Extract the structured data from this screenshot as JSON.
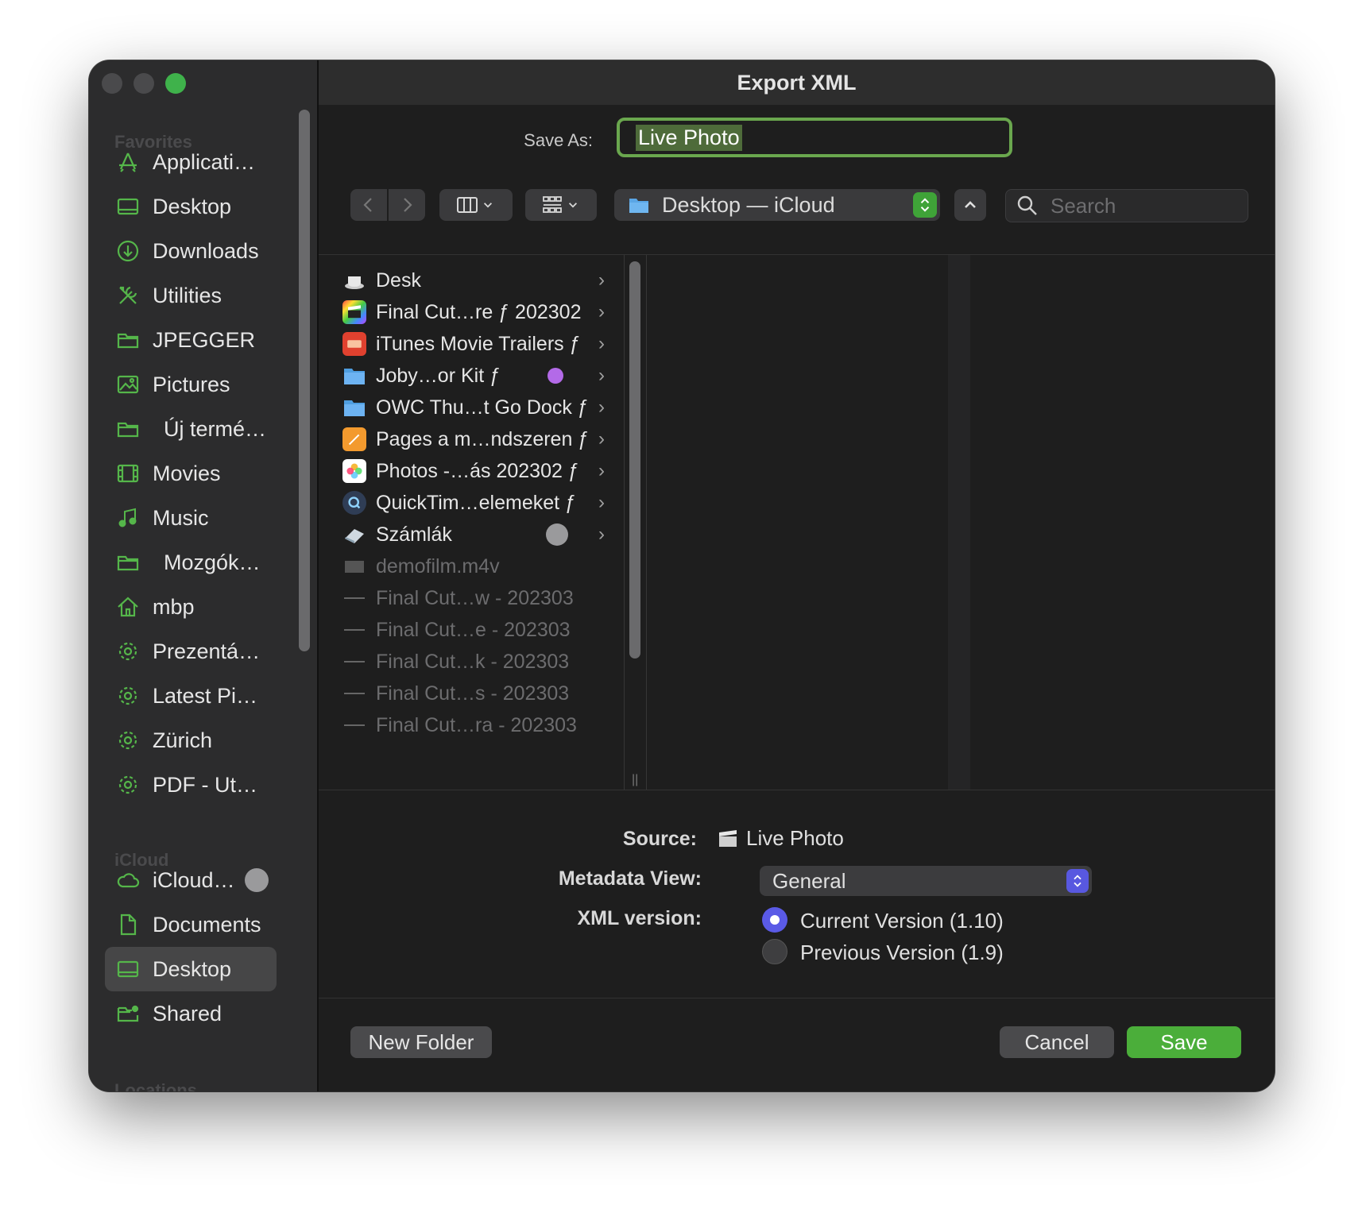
{
  "window": {
    "title": "Export XML"
  },
  "sidebar": {
    "sections": {
      "favorites": "Favorites",
      "icloud": "iCloud",
      "locations": "Locations"
    },
    "items": [
      {
        "label": "Applicati…",
        "icon": "applications-icon"
      },
      {
        "label": "Desktop",
        "icon": "desktop-icon"
      },
      {
        "label": "Downloads",
        "icon": "downloads-icon"
      },
      {
        "label": "Utilities",
        "icon": "utilities-icon"
      },
      {
        "label": "JPEGGER",
        "icon": "folder-icon"
      },
      {
        "label": "Pictures",
        "icon": "pictures-icon"
      },
      {
        "label": "Új termé…",
        "icon": "folder-icon"
      },
      {
        "label": "Movies",
        "icon": "movies-icon"
      },
      {
        "label": "Music",
        "icon": "music-icon"
      },
      {
        "label": "Mozgók…",
        "icon": "folder-icon"
      },
      {
        "label": "mbp",
        "icon": "home-icon"
      },
      {
        "label": "Prezentá…",
        "icon": "gear-icon"
      },
      {
        "label": "Latest Pi…",
        "icon": "gear-icon"
      },
      {
        "label": "Zürich",
        "icon": "gear-icon"
      },
      {
        "label": "PDF - Ut…",
        "icon": "gear-icon"
      }
    ],
    "icloud_items": [
      {
        "label": "iCloud…",
        "icon": "cloud-icon"
      },
      {
        "label": "Documents",
        "icon": "document-icon"
      },
      {
        "label": "Desktop",
        "icon": "desktop-icon",
        "selected": true
      },
      {
        "label": "Shared",
        "icon": "shared-folder-icon"
      }
    ]
  },
  "save_as": {
    "label": "Save As:",
    "value": "Live Photo"
  },
  "toolbar": {
    "path_popup": "Desktop — iCloud",
    "search_placeholder": "Search"
  },
  "browser": {
    "files": [
      {
        "name": "Desk",
        "icon": "cup-icon",
        "folder": true
      },
      {
        "name": "Final Cut…re ƒ 202302",
        "icon": "clapper-icon",
        "folder": true
      },
      {
        "name": "iTunes Movie Trailers ƒ",
        "icon": "ticket-icon",
        "folder": true
      },
      {
        "name": "Joby…or Kit ƒ",
        "icon": "folder-icon",
        "folder": true,
        "tag": "purple"
      },
      {
        "name": "OWC Thu…t Go Dock ƒ",
        "icon": "folder-icon",
        "folder": true
      },
      {
        "name": "Pages a m…ndszeren ƒ",
        "icon": "pages-icon",
        "folder": true
      },
      {
        "name": "Photos -…ás 202302 ƒ",
        "icon": "photos-icon",
        "folder": true
      },
      {
        "name": "QuickTim…elemeket ƒ",
        "icon": "quicktime-icon",
        "folder": true
      },
      {
        "name": "Számlák",
        "icon": "eraser-icon",
        "folder": true,
        "progress": true
      },
      {
        "name": "demofilm.m4v",
        "icon": "video-file-icon",
        "folder": false
      },
      {
        "name": "Final Cut…w - 202303",
        "icon": "file-line-icon",
        "folder": false
      },
      {
        "name": "Final Cut…e - 202303",
        "icon": "file-line-icon",
        "folder": false
      },
      {
        "name": "Final Cut…k - 202303",
        "icon": "file-line-icon",
        "folder": false
      },
      {
        "name": "Final Cut…s - 202303",
        "icon": "file-line-icon",
        "folder": false
      },
      {
        "name": "Final Cut…ra - 202303",
        "icon": "file-line-icon",
        "folder": false
      }
    ]
  },
  "options": {
    "source_label": "Source:",
    "source_value": "Live Photo",
    "metadata_label": "Metadata View:",
    "metadata_value": "General",
    "xml_label": "XML version:",
    "xml_options": [
      "Current Version (1.10)",
      "Previous Version (1.9)"
    ]
  },
  "buttons": {
    "new_folder": "New Folder",
    "cancel": "Cancel",
    "save": "Save"
  },
  "colors": {
    "accent": "#4bae3a",
    "selected_radio": "#5a5ae6",
    "tag_purple": "#b36ae8"
  }
}
